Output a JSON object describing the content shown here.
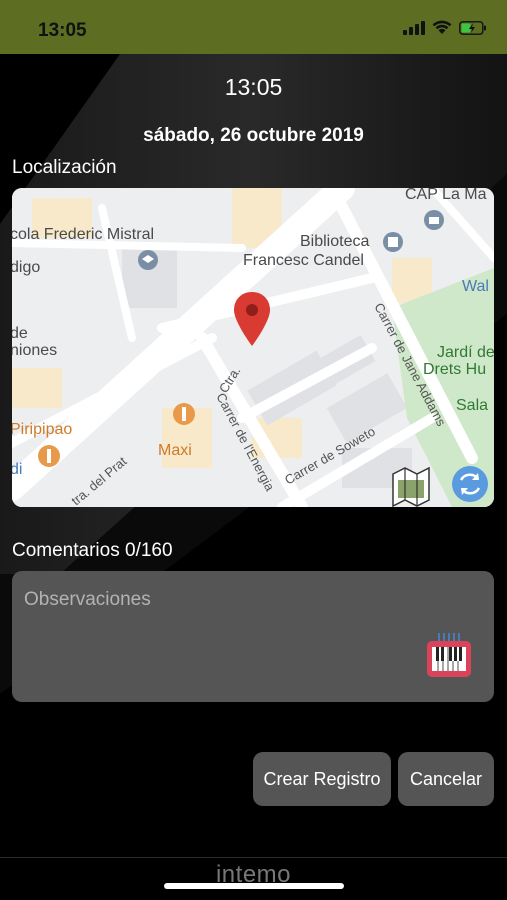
{
  "status_bar": {
    "time": "13:05"
  },
  "header": {
    "clock": "13:05",
    "date": "sábado, 26 octubre 2019"
  },
  "location": {
    "label": "Localización",
    "map_labels": {
      "school": "cola Frederic Mistral",
      "school_frag": "digo",
      "library_line1": "Biblioteca",
      "library_line2": "Francesc Candel",
      "cap": "CAP La Ma",
      "wal": "Wal",
      "de": "de",
      "niones": "niones",
      "jardi_line1": "Jardí de",
      "jardi_line2": "Drets Hu",
      "sala": "Sala",
      "piripipao": "Piripipao",
      "maxi": "Maxi",
      "ctra": "Ctra.",
      "prat": "tra. del Prat",
      "energia": "Carrer de l'Energia",
      "soweto": "Carrer de Soweto",
      "jane": "Carrer de Jane Addams",
      "di": "di"
    }
  },
  "comments": {
    "label": "Comentarios",
    "counter": "0/160",
    "placeholder": "Observaciones"
  },
  "actions": {
    "create": "Crear Registro",
    "cancel": "Cancelar"
  },
  "footer": {
    "brand": "intemo"
  },
  "colors": {
    "status_bar": "#5d6e22",
    "panel": "#555555",
    "pin": "#d93a32",
    "park": "#cfe8c9"
  }
}
